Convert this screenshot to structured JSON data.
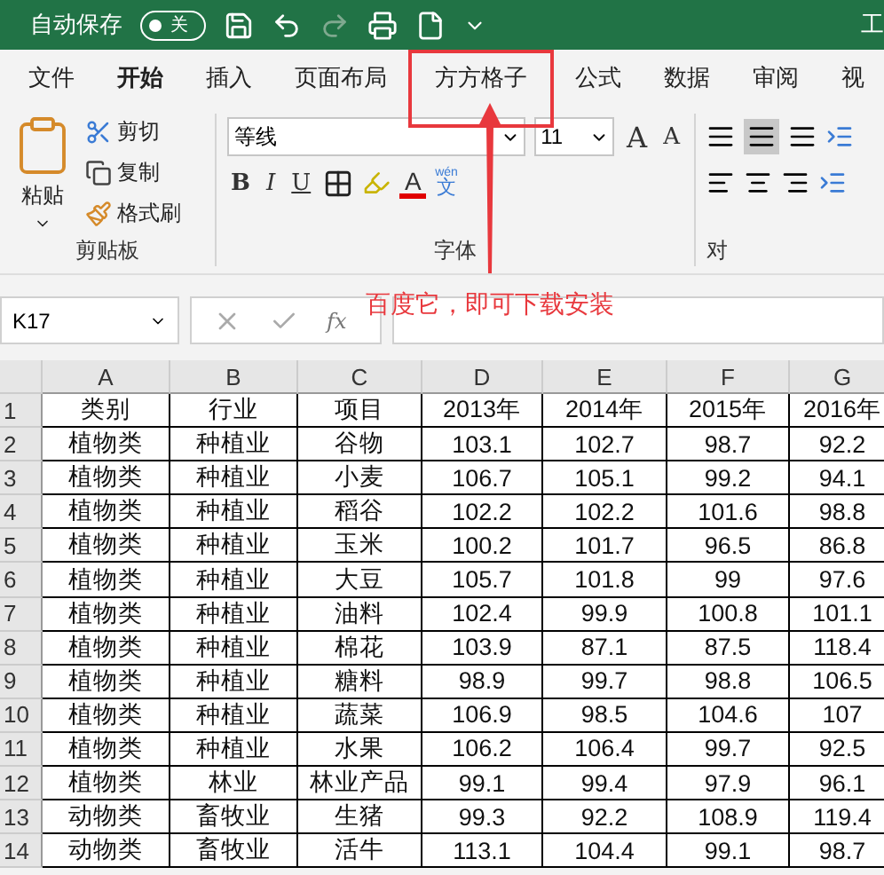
{
  "title_bar": {
    "autosave_label": "自动保存",
    "autosave": {
      "label": "关",
      "on": false
    },
    "title": "工"
  },
  "tabs": [
    {
      "label": "文件",
      "selected": false,
      "boxed": false
    },
    {
      "label": "开始",
      "selected": true,
      "boxed": false
    },
    {
      "label": "插入",
      "selected": false,
      "boxed": false
    },
    {
      "label": "页面布局",
      "selected": false,
      "boxed": false
    },
    {
      "label": "方方格子",
      "selected": false,
      "boxed": true
    },
    {
      "label": "公式",
      "selected": false,
      "boxed": false
    },
    {
      "label": "数据",
      "selected": false,
      "boxed": false
    },
    {
      "label": "审阅",
      "selected": false,
      "boxed": false
    },
    {
      "label": "视",
      "selected": false,
      "boxed": false
    }
  ],
  "ribbon": {
    "clipboard": {
      "paste": "粘贴",
      "items": [
        {
          "kind": "cut",
          "label": "剪切"
        },
        {
          "kind": "copy",
          "label": "复制"
        },
        {
          "kind": "painter",
          "label": "格式刷"
        }
      ],
      "label": "剪贴板"
    },
    "font": {
      "font_name": "等线",
      "font_size": "11",
      "grow": "A",
      "shrink": "A",
      "bold": "B",
      "italic": "I",
      "underline": "U",
      "font_color": "A",
      "phonetic_top": "wén",
      "phonetic_bottom": "文",
      "label": "字体"
    },
    "alignment": {
      "label": "对"
    }
  },
  "annotation": {
    "text": "百度它，即可下载安装"
  },
  "formula_bar": {
    "name_box": "K17",
    "fx": "fx"
  },
  "sheet": {
    "columns": [
      "A",
      "B",
      "C",
      "D",
      "E",
      "F",
      "G"
    ],
    "rows": [
      {
        "n": "1",
        "cells": [
          "类别",
          "行业",
          "项目",
          "2013年",
          "2014年",
          "2015年",
          "2016年"
        ]
      },
      {
        "n": "2",
        "cells": [
          "植物类",
          "种植业",
          "谷物",
          "103.1",
          "102.7",
          "98.7",
          "92.2"
        ]
      },
      {
        "n": "3",
        "cells": [
          "植物类",
          "种植业",
          "小麦",
          "106.7",
          "105.1",
          "99.2",
          "94.1"
        ]
      },
      {
        "n": "4",
        "cells": [
          "植物类",
          "种植业",
          "稻谷",
          "102.2",
          "102.2",
          "101.6",
          "98.8"
        ]
      },
      {
        "n": "5",
        "cells": [
          "植物类",
          "种植业",
          "玉米",
          "100.2",
          "101.7",
          "96.5",
          "86.8"
        ]
      },
      {
        "n": "6",
        "cells": [
          "植物类",
          "种植业",
          "大豆",
          "105.7",
          "101.8",
          "99",
          "97.6"
        ]
      },
      {
        "n": "7",
        "cells": [
          "植物类",
          "种植业",
          "油料",
          "102.4",
          "99.9",
          "100.8",
          "101.1"
        ]
      },
      {
        "n": "8",
        "cells": [
          "植物类",
          "种植业",
          "棉花",
          "103.9",
          "87.1",
          "87.5",
          "118.4"
        ]
      },
      {
        "n": "9",
        "cells": [
          "植物类",
          "种植业",
          "糖料",
          "98.9",
          "99.7",
          "98.8",
          "106.5"
        ]
      },
      {
        "n": "10",
        "cells": [
          "植物类",
          "种植业",
          "蔬菜",
          "106.9",
          "98.5",
          "104.6",
          "107"
        ]
      },
      {
        "n": "11",
        "cells": [
          "植物类",
          "种植业",
          "水果",
          "106.2",
          "106.4",
          "99.7",
          "92.5"
        ]
      },
      {
        "n": "12",
        "cells": [
          "植物类",
          "林业",
          "林业产品",
          "99.1",
          "99.4",
          "97.9",
          "96.1"
        ]
      },
      {
        "n": "13",
        "cells": [
          "动物类",
          "畜牧业",
          "生猪",
          "99.3",
          "92.2",
          "108.9",
          "119.4"
        ]
      },
      {
        "n": "14",
        "cells": [
          "动物类",
          "畜牧业",
          "活牛",
          "113.1",
          "104.4",
          "99.1",
          "98.7"
        ]
      }
    ]
  }
}
